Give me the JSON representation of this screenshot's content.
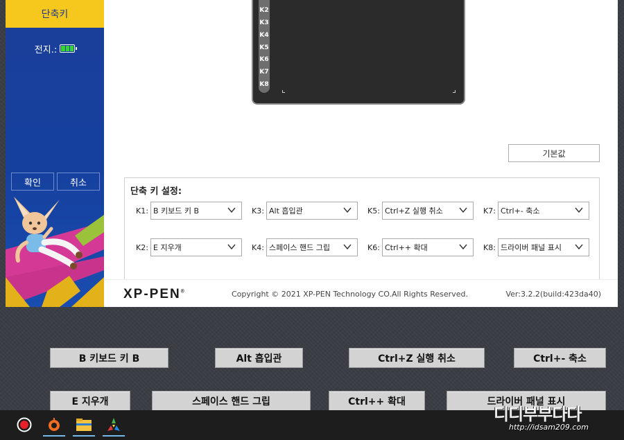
{
  "sidebar": {
    "active_item": "단축키",
    "battery_label": "전지.:",
    "confirm_label": "확인",
    "cancel_label": "취소"
  },
  "tablet": {
    "keys": [
      "K2",
      "K3",
      "K4",
      "K5",
      "K6",
      "K7",
      "K8"
    ]
  },
  "default_button": "기본값",
  "shortcuts": {
    "title": "단축 키 설정:",
    "slots": [
      {
        "key": "K1:",
        "value": "B 키보드 키 B"
      },
      {
        "key": "K3:",
        "value": "Alt 흡입관"
      },
      {
        "key": "K5:",
        "value": "Ctrl+Z 실행 취소"
      },
      {
        "key": "K7:",
        "value": "Ctrl+- 축소"
      },
      {
        "key": "K2:",
        "value": "E 지우개"
      },
      {
        "key": "K4:",
        "value": "스페이스 핸드 그립"
      },
      {
        "key": "K6:",
        "value": "Ctrl++ 확대"
      },
      {
        "key": "K8:",
        "value": "드라이버 패널 표시"
      }
    ]
  },
  "footer": {
    "logo": "XP-PEN",
    "logo_mark": "®",
    "copyright": "Copyright © 2021 XP-PEN Technology CO.All Rights Reserved.",
    "version": "Ver:3.2.2(build:423da40)"
  },
  "overlay_buttons": [
    "B 키보드 키 B",
    "Alt 흡입관",
    "Ctrl+Z 실행 취소",
    "Ctrl+- 축소",
    "E 지우개",
    "스페이스 핸드 그립",
    "Ctrl++ 확대",
    "드라이버 패널 표시"
  ],
  "taskbar": {
    "icons": [
      "record-icon",
      "origin-icon",
      "file-explorer-icon",
      "color-app-icon"
    ]
  },
  "watermark": {
    "text": "디디부부다다",
    "url": "http://idsam209.com"
  },
  "colors": {
    "sidebar_blue": "#15409e",
    "active_yellow": "#f6c71d",
    "battery_green": "#35d23a",
    "taskbar_underline": "#76b9ed"
  }
}
